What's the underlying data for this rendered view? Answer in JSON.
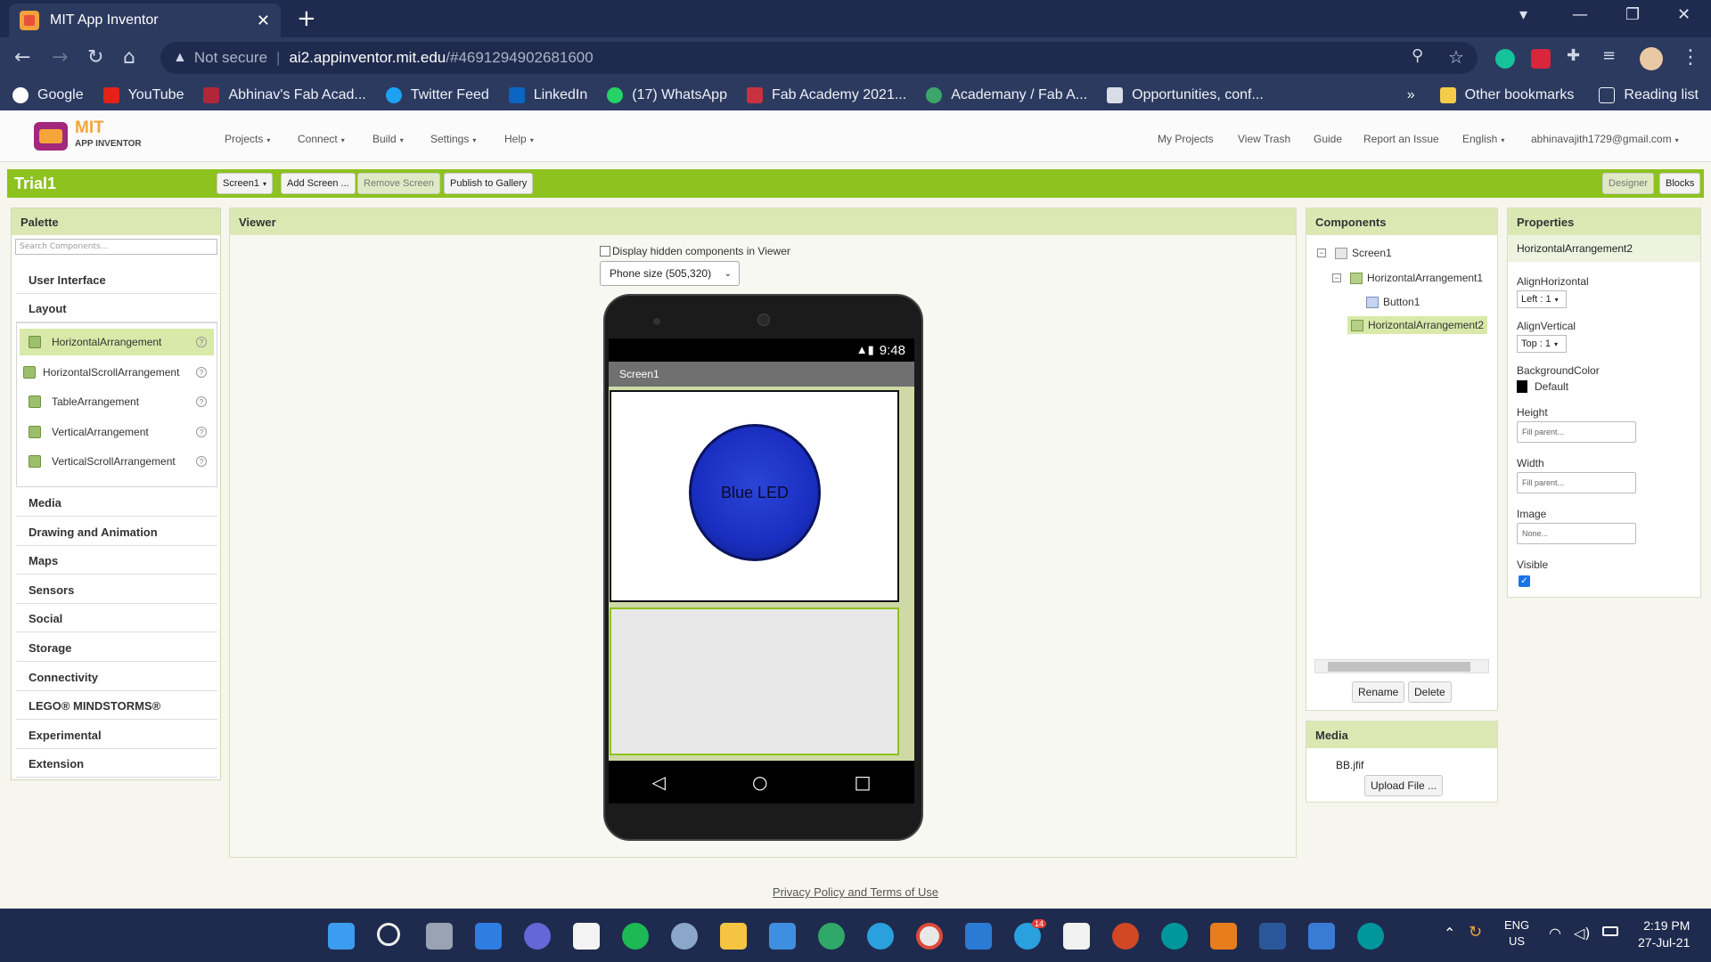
{
  "browser": {
    "tab_title": "MIT App Inventor",
    "not_secure": "Not secure",
    "url_host": "ai2.appinventor.mit.edu",
    "url_path": "/#4691294902681600",
    "bookmarks": [
      "Google",
      "YouTube",
      "Abhinav's Fab Acad...",
      "Twitter Feed",
      "LinkedIn",
      "(17) WhatsApp",
      "Fab Academy 2021...",
      "Academany / Fab A...",
      "Opportunities, conf..."
    ],
    "other_bookmarks": "Other bookmarks",
    "reading_list": "Reading list",
    "more": "»"
  },
  "app": {
    "logo_top": "MIT",
    "logo_bottom": "APP INVENTOR",
    "menus": [
      "Projects",
      "Connect",
      "Build",
      "Settings",
      "Help"
    ],
    "right_links": [
      "My Projects",
      "View Trash",
      "Guide",
      "Report an Issue",
      "English",
      "abhinavajith1729@gmail.com"
    ]
  },
  "project": {
    "name": "Trial1",
    "screen_select": "Screen1",
    "add_screen": "Add Screen ...",
    "remove_screen": "Remove Screen",
    "publish": "Publish to Gallery",
    "designer": "Designer",
    "blocks": "Blocks"
  },
  "palette": {
    "title": "Palette",
    "search_placeholder": "Search Components...",
    "categories_top": [
      "User Interface",
      "Layout"
    ],
    "layout_items": [
      "HorizontalArrangement",
      "HorizontalScrollArrangement",
      "TableArrangement",
      "VerticalArrangement",
      "VerticalScrollArrangement"
    ],
    "categories_bottom": [
      "Media",
      "Drawing and Animation",
      "Maps",
      "Sensors",
      "Social",
      "Storage",
      "Connectivity",
      "LEGO® MINDSTORMS®",
      "Experimental",
      "Extension"
    ]
  },
  "viewer": {
    "title": "Viewer",
    "hidden_label": "Display hidden components in Viewer",
    "phone_size": "Phone size (505,320)",
    "time": "9:48",
    "screen_title": "Screen1",
    "button_text": "Blue LED"
  },
  "components": {
    "title": "Components",
    "tree": [
      "Screen1",
      "HorizontalArrangement1",
      "Button1",
      "HorizontalArrangement2"
    ],
    "rename": "Rename",
    "delete": "Delete"
  },
  "media": {
    "title": "Media",
    "file": "BB.jfif",
    "upload": "Upload File ..."
  },
  "properties": {
    "title": "Properties",
    "selected": "HorizontalArrangement2",
    "align_h_label": "AlignHorizontal",
    "align_h_value": "Left : 1",
    "align_v_label": "AlignVertical",
    "align_v_value": "Top : 1",
    "bg_label": "BackgroundColor",
    "bg_value": "Default",
    "height_label": "Height",
    "height_value": "Fill parent...",
    "width_label": "Width",
    "width_value": "Fill parent...",
    "image_label": "Image",
    "image_value": "None...",
    "visible_label": "Visible"
  },
  "footer": {
    "privacy": "Privacy Policy and Terms of Use"
  },
  "taskbar": {
    "lang1": "ENG",
    "lang2": "US",
    "time": "2:19 PM",
    "date": "27-Jul-21",
    "badge": "14"
  },
  "colors": {
    "accent_green": "#8dc21f",
    "chrome_bg": "#1f2b4e"
  }
}
